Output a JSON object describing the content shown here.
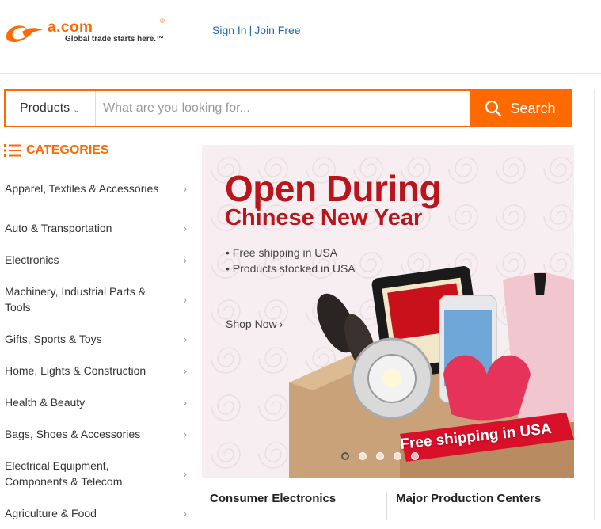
{
  "header": {
    "logo_text": "a.com",
    "logo_reg": "®",
    "tagline": "Global trade starts here.™",
    "sign_in": "Sign In",
    "separator": "|",
    "join_free": "Join Free"
  },
  "search": {
    "category": "Products",
    "placeholder": "What are you looking for...",
    "button_label": "Search"
  },
  "categories": {
    "title": "CATEGORIES",
    "items": [
      {
        "label": "Apparel, Textiles & Accessories"
      },
      {
        "label": "Auto & Transportation"
      },
      {
        "label": "Electronics"
      },
      {
        "label": "Machinery, Industrial Parts & Tools"
      },
      {
        "label": "Gifts, Sports & Toys"
      },
      {
        "label": "Home, Lights & Construction"
      },
      {
        "label": "Health & Beauty"
      },
      {
        "label": "Bags, Shoes & Accessories"
      },
      {
        "label": "Electrical Equipment, Components & Telecom"
      },
      {
        "label": "Agriculture & Food"
      }
    ],
    "arrow": "›"
  },
  "banner": {
    "title_line1": "Open During",
    "title_line2": "Chinese New Year",
    "bullets": [
      "Free shipping in USA",
      "Products stocked in USA"
    ],
    "shop_now": "Shop Now",
    "shop_now_chevron": "›",
    "ribbon": "Free shipping in USA",
    "slides": 5,
    "active_slide": 1,
    "title_color": "#b8161c"
  },
  "sections": {
    "left": "Consumer Electronics",
    "right": "Major Production Centers"
  },
  "colors": {
    "brand": "#ff6a00",
    "link": "#1e6ab3"
  }
}
